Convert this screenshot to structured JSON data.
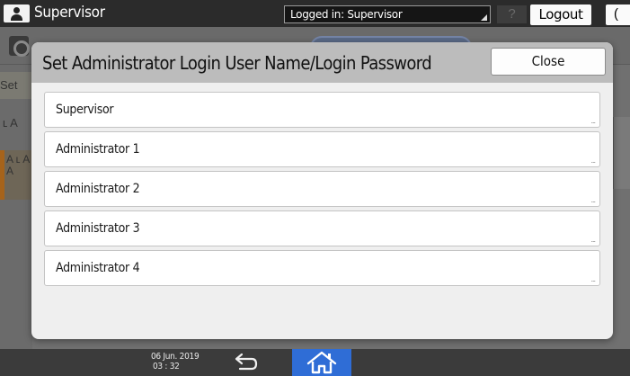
{
  "topbar": {
    "user_name": "Supervisor",
    "login_status": "Logged in: Supervisor",
    "help_label": "?",
    "logout_label": "Logout",
    "sleep_label": "("
  },
  "background": {
    "left_items": [
      "Set",
      "ʟ A",
      "A ʟ A A"
    ]
  },
  "dialog": {
    "title": "Set Administrator Login User Name/Login Password",
    "close_label": "Close",
    "users": [
      {
        "label": "Supervisor",
        "more": "..."
      },
      {
        "label": "Administrator 1",
        "more": "..."
      },
      {
        "label": "Administrator 2",
        "more": "..."
      },
      {
        "label": "Administrator 3",
        "more": "..."
      },
      {
        "label": "Administrator 4",
        "more": "..."
      }
    ]
  },
  "bottombar": {
    "date": "06 Jun. 2019",
    "time": "03 : 32"
  },
  "colors": {
    "accent_home": "#2f6dd6",
    "dialog_header": "#bcbcbc",
    "topbar": "#2b2b2b"
  }
}
